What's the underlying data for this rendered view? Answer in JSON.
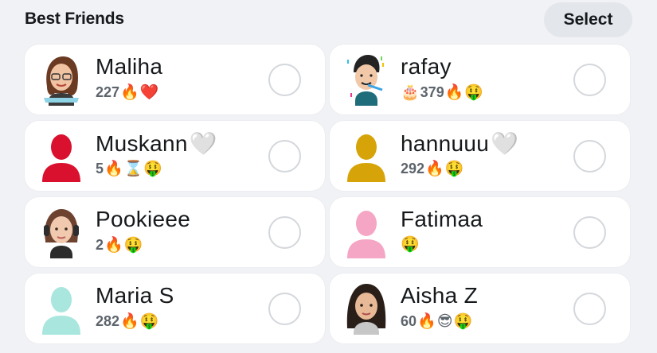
{
  "header": {
    "title": "Best Friends",
    "select_label": "Select"
  },
  "friends": [
    {
      "name": "Maliha",
      "name_emoji": "",
      "count": "227",
      "emojis": [
        "🔥",
        "❤️"
      ],
      "avatar": "bitmoji-girl-glasses-icon"
    },
    {
      "name": "rafay",
      "name_emoji": "",
      "count": "379",
      "prefix_emoji": "🎂",
      "emojis": [
        "🔥",
        "🤑"
      ],
      "avatar": "bitmoji-boy-party-icon"
    },
    {
      "name": "Muskann",
      "name_emoji": "🤍",
      "count": "5",
      "emojis": [
        "🔥",
        "⌛",
        "🤑"
      ],
      "avatar": "silhouette-red-icon",
      "color": "#d9102e"
    },
    {
      "name": "hannuuu",
      "name_emoji": "🤍",
      "count": "292",
      "emojis": [
        "🔥",
        "🤑"
      ],
      "avatar": "silhouette-gold-icon",
      "color": "#d6a408"
    },
    {
      "name": "Pookieee",
      "name_emoji": "",
      "count": "2",
      "emojis": [
        "🔥",
        "🤑"
      ],
      "avatar": "bitmoji-girl-headphones-icon"
    },
    {
      "name": "Fatimaa",
      "name_emoji": "",
      "count": "",
      "emojis": [
        "🤑"
      ],
      "avatar": "silhouette-pink-icon",
      "color": "#f4a6c4"
    },
    {
      "name": "Maria S",
      "name_emoji": "",
      "count": "282",
      "emojis": [
        "🔥",
        "🤑"
      ],
      "avatar": "silhouette-mint-icon",
      "color": "#a8e6de"
    },
    {
      "name": "Aisha Z",
      "name_emoji": "",
      "count": "60",
      "emojis": [
        "🔥",
        "😎",
        "🤑"
      ],
      "avatar": "bitmoji-girl-dark-hair-icon"
    }
  ]
}
